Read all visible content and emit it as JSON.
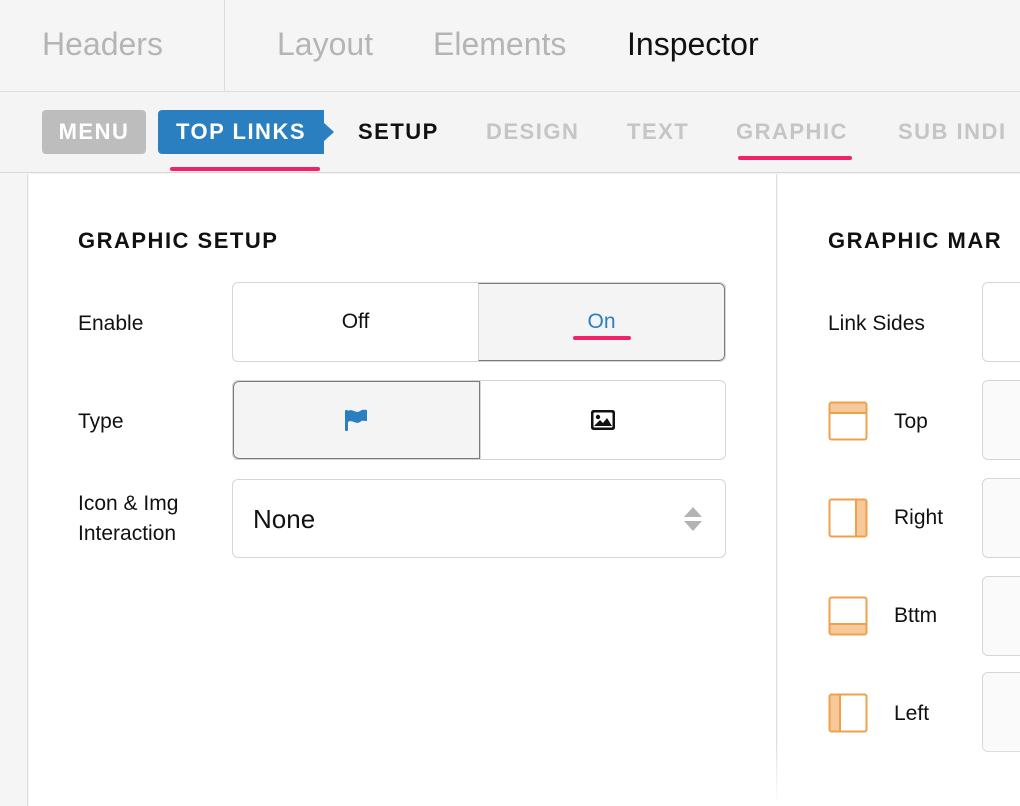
{
  "top_tabs": {
    "headers": "Headers",
    "layout": "Layout",
    "elements": "Elements",
    "inspector": "Inspector"
  },
  "breadcrumb": {
    "menu": "MENU",
    "top_links": "TOP LINKS"
  },
  "sub_tabs": {
    "setup": "SETUP",
    "design": "DESIGN",
    "text": "TEXT",
    "graphic": "GRAPHIC",
    "sub_indicator": "SUB INDI"
  },
  "graphic_setup": {
    "title": "GRAPHIC SETUP",
    "enable_label": "Enable",
    "enable_off": "Off",
    "enable_on": "On",
    "enable_value": "On",
    "type_label": "Type",
    "type_value": "icon",
    "type_options": [
      "flag-icon",
      "image-icon"
    ],
    "interaction_label_1": "Icon & Img",
    "interaction_label_2": "Interaction",
    "interaction_value": "None"
  },
  "graphic_margin": {
    "title": "GRAPHIC MAR",
    "link_sides_label": "Link Sides",
    "top_label": "Top",
    "right_label": "Right",
    "bottom_label": "Bttm",
    "left_label": "Left"
  },
  "colors": {
    "accent_blue": "#2a7fc0",
    "indicator_pink": "#f0226a",
    "side_orange": "#f0a04b"
  }
}
